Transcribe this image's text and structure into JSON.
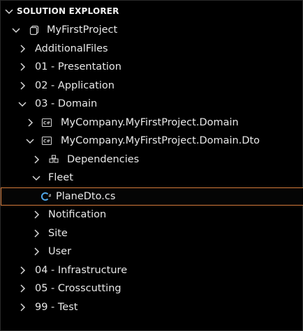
{
  "panel": {
    "title": "SOLUTION EXPLORER"
  },
  "tree": [
    {
      "label": "MyFirstProject",
      "level": 1,
      "expanded": true,
      "twisty": true,
      "icon": "solution-icon"
    },
    {
      "label": "AdditionalFiles",
      "level": 2,
      "expanded": false,
      "twisty": true,
      "icon": ""
    },
    {
      "label": "01 - Presentation",
      "level": 2,
      "expanded": false,
      "twisty": true,
      "icon": ""
    },
    {
      "label": "02 - Application",
      "level": 2,
      "expanded": false,
      "twisty": true,
      "icon": ""
    },
    {
      "label": "03 - Domain",
      "level": 2,
      "expanded": true,
      "twisty": true,
      "icon": ""
    },
    {
      "label": "MyCompany.MyFirstProject.Domain",
      "level": 3,
      "expanded": false,
      "twisty": true,
      "icon": "csharp-project-icon"
    },
    {
      "label": "MyCompany.MyFirstProject.Domain.Dto",
      "level": 3,
      "expanded": true,
      "twisty": true,
      "icon": "csharp-project-icon"
    },
    {
      "label": "Dependencies",
      "level": 4,
      "expanded": false,
      "twisty": true,
      "icon": "dependencies-icon"
    },
    {
      "label": "Fleet",
      "level": 4,
      "expanded": true,
      "twisty": true,
      "icon": ""
    },
    {
      "label": "PlaneDto.cs",
      "level": 5,
      "expanded": false,
      "twisty": false,
      "icon": "csharp-file-icon",
      "selected": true
    },
    {
      "label": "Notification",
      "level": 4,
      "expanded": false,
      "twisty": true,
      "icon": ""
    },
    {
      "label": "Site",
      "level": 4,
      "expanded": false,
      "twisty": true,
      "icon": ""
    },
    {
      "label": "User",
      "level": 4,
      "expanded": false,
      "twisty": true,
      "icon": ""
    },
    {
      "label": "04 - Infrastructure",
      "level": 2,
      "expanded": false,
      "twisty": true,
      "icon": ""
    },
    {
      "label": "05 - Crosscutting",
      "level": 2,
      "expanded": false,
      "twisty": true,
      "icon": ""
    },
    {
      "label": "99 - Test",
      "level": 2,
      "expanded": false,
      "twisty": true,
      "icon": ""
    }
  ],
  "colors": {
    "background": "#000000",
    "selection_border": "#d57a3a",
    "csharp_accent": "#4fa6e8"
  }
}
